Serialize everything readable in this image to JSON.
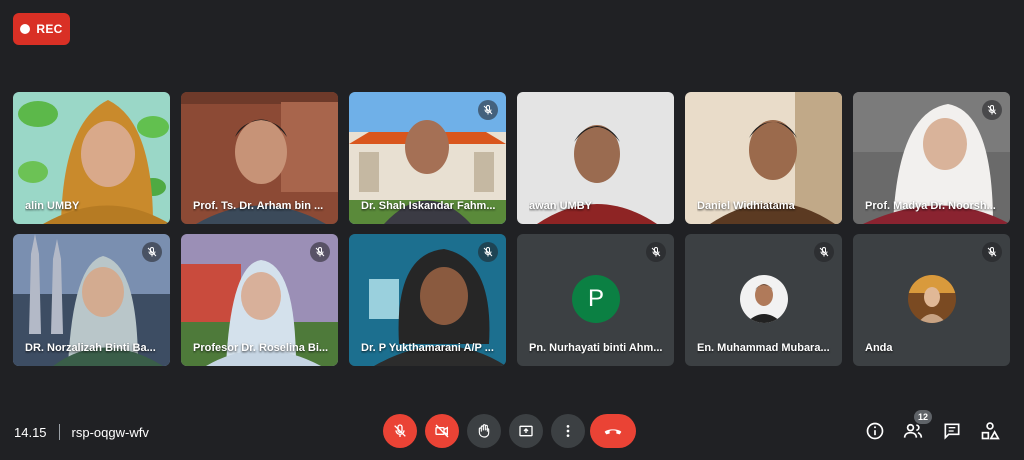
{
  "recording": {
    "label": "REC"
  },
  "participants": [
    {
      "name": "alin UMBY",
      "muted": false
    },
    {
      "name": "Prof. Ts. Dr. Arham bin ...",
      "muted": false
    },
    {
      "name": "Dr. Shah Iskandar Fahm...",
      "muted": true
    },
    {
      "name": "awan UMBY",
      "muted": false
    },
    {
      "name": "Daniel Widhiatama",
      "muted": false
    },
    {
      "name": "Prof. Madya Dr. Noorsh...",
      "muted": true
    },
    {
      "name": "DR. Norzalizah Binti Ba...",
      "muted": true
    },
    {
      "name": "Profesor Dr. Roselina Bi...",
      "muted": true
    },
    {
      "name": "Dr. P Yukthamarani A/P ...",
      "muted": true
    },
    {
      "name": "Pn. Nurhayati binti Ahm...",
      "muted": true,
      "avatar_letter": "P"
    },
    {
      "name": "En. Muhammad Mubara...",
      "muted": true
    },
    {
      "name": "Anda",
      "muted": true
    }
  ],
  "meeting": {
    "time": "14.15",
    "code": "rsp-oqgw-wfv"
  },
  "controls": {
    "mic": "mic-off-icon",
    "camera": "camera-off-icon",
    "hand": "raise-hand-icon",
    "present": "present-screen-icon",
    "more": "more-options-icon",
    "leave": "hang-up-icon"
  },
  "side_controls": {
    "people_count": "12"
  },
  "colors": {
    "accent_red": "#ea4335",
    "background": "#202124",
    "tile": "#3c4043",
    "avatar_green": "#0b8043"
  }
}
